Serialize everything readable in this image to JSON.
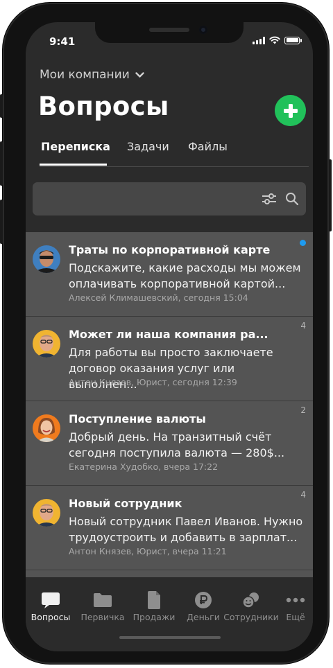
{
  "status": {
    "time": "9:41"
  },
  "header": {
    "company_selector": "Мои компании",
    "title": "Вопросы",
    "add_icon": "plus-icon"
  },
  "tabs": [
    {
      "label": "Переписка",
      "active": true
    },
    {
      "label": "Задачи",
      "active": false
    },
    {
      "label": "Файлы",
      "active": false
    }
  ],
  "search": {
    "placeholder": "",
    "filter_icon": "sliders-icon",
    "search_icon": "magnifier-icon"
  },
  "conversations": [
    {
      "title": "Траты по корпоративной карте",
      "message": "Подскажите, какие расходы мы можем\nоплачивать корпоративной картой...",
      "meta": "Алексей Климашевский, сегодня 15:04",
      "badge": "",
      "unread_dot": true
    },
    {
      "title": "Может ли наша компания ра...",
      "message": "Для работы вы просто заключаете\nдоговор оказания услуг или выполнен...",
      "meta": "Антон Князев, Юрист, сегодня 12:39",
      "badge": "4",
      "unread_dot": false
    },
    {
      "title": "Поступление валюты",
      "message": "Добрый день. На транзитный счёт\nсегодня поступила валюта — 280$...",
      "meta": "Екатерина Худобко, вчера 17:22",
      "badge": "2",
      "unread_dot": false
    },
    {
      "title": "Новый сотрудник",
      "message": "Новый сотрудник Павел Иванов. Нужно\nтрудоустроить и добавить в зарплат...",
      "meta": "Антон Князев, Юрист, вчера 11:21",
      "badge": "4",
      "unread_dot": false
    }
  ],
  "bottom_nav": [
    {
      "label": "Вопросы",
      "icon": "chat-bubble-icon",
      "active": true
    },
    {
      "label": "Первичка",
      "icon": "folder-icon",
      "active": false
    },
    {
      "label": "Продажи",
      "icon": "document-icon",
      "active": false
    },
    {
      "label": "Деньги",
      "icon": "ruble-coin-icon",
      "active": false
    },
    {
      "label": "Сотрудники",
      "icon": "people-icon",
      "active": false
    },
    {
      "label": "Ещё",
      "icon": "more-dots-icon",
      "active": false
    }
  ],
  "colors": {
    "accent_green": "#21c15a",
    "unread_dot": "#1e9bf0",
    "background": "#2b2b2b",
    "card": "#545454"
  }
}
